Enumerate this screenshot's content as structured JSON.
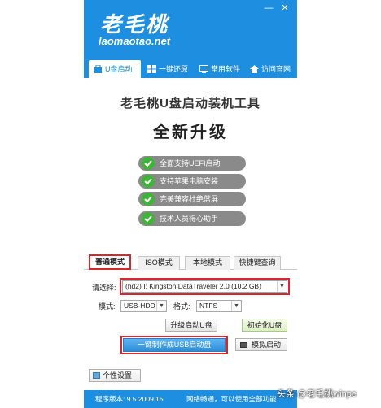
{
  "app": {
    "logo_cn": "老毛桃",
    "logo_url": "laomaotao.net",
    "minimize_glyph": "—",
    "close_glyph": "✕"
  },
  "tabs": [
    {
      "label": "U盘启动",
      "icon": "usb-icon",
      "active": true
    },
    {
      "label": "一键还原",
      "icon": "windows-icon",
      "active": false
    },
    {
      "label": "常用软件",
      "icon": "monitor-icon",
      "active": false
    },
    {
      "label": "访问官网",
      "icon": "home-icon",
      "active": false
    }
  ],
  "main": {
    "title": "老毛桃U盘启动装机工具",
    "subtitle": "全新升级"
  },
  "features": [
    "全面支持UEFI启动",
    "支持苹果电脑安装",
    "完美兼容杜绝蓝屏",
    "技术人员得心助手"
  ],
  "mode_tabs": [
    {
      "label": "普通模式",
      "active": true
    },
    {
      "label": "ISO模式",
      "active": false
    },
    {
      "label": "本地模式",
      "active": false
    },
    {
      "label": "快捷键查询",
      "active": false
    }
  ],
  "form": {
    "select_label": "请选择:",
    "device_value": "(hd2) I: Kingston DataTraveler 2.0 (10.2 GB)",
    "mode_label": "模式:",
    "mode_value": "USB-HDD",
    "format_label": "格式:",
    "format_value": "NTFS"
  },
  "buttons": {
    "upgrade": "升级启动U盘",
    "init": "初始化U盘",
    "make": "一键制作成USB启动盘",
    "simulate": "模拟启动",
    "custom": "个性设置"
  },
  "status": {
    "version": "程序版本: 9.5.2009.15",
    "note": "网络畅通，可以使用全部功能"
  },
  "watermark": "头条 @老毛桃winpe",
  "colors": {
    "brand_blue": "#1e8ee0",
    "highlight_red": "#d9262c",
    "check_green": "#3fb538",
    "pill_gray": "#8a8a8a"
  }
}
